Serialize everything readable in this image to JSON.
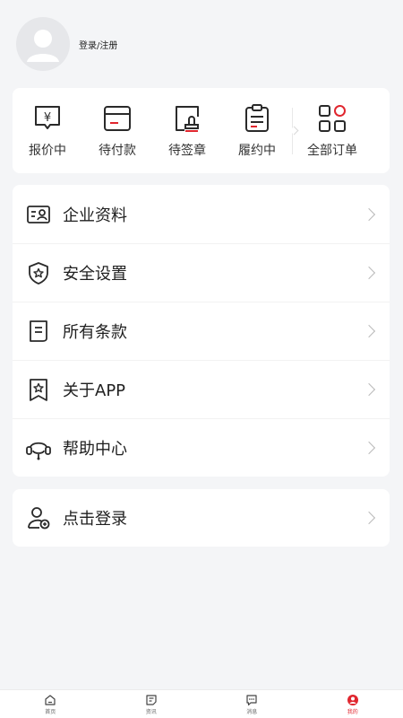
{
  "colors": {
    "accent": "#e0262e",
    "background": "#f4f5f7"
  },
  "profile": {
    "login_label": "登录/注册"
  },
  "orders": {
    "items": [
      {
        "label": "报价中",
        "icon": "quote-yen-icon"
      },
      {
        "label": "待付款",
        "icon": "card-payment-icon"
      },
      {
        "label": "待签章",
        "icon": "stamp-icon"
      },
      {
        "label": "履约中",
        "icon": "clipboard-icon"
      }
    ],
    "all_label": "全部订单",
    "all_icon": "grid-icon"
  },
  "menu": {
    "items": [
      {
        "label": "企业资料",
        "icon": "id-card-icon"
      },
      {
        "label": "安全设置",
        "icon": "shield-star-icon"
      },
      {
        "label": "所有条款",
        "icon": "document-icon"
      },
      {
        "label": "关于APP",
        "icon": "bookmark-star-icon"
      },
      {
        "label": "帮助中心",
        "icon": "headset-icon"
      }
    ]
  },
  "login": {
    "label": "点击登录",
    "icon": "user-add-icon"
  },
  "tabbar": {
    "items": [
      {
        "label": "首页",
        "icon": "home-icon"
      },
      {
        "label": "资讯",
        "icon": "news-icon"
      },
      {
        "label": "消息",
        "icon": "message-icon"
      },
      {
        "label": "我的",
        "icon": "profile-icon"
      }
    ],
    "active_index": 3
  }
}
